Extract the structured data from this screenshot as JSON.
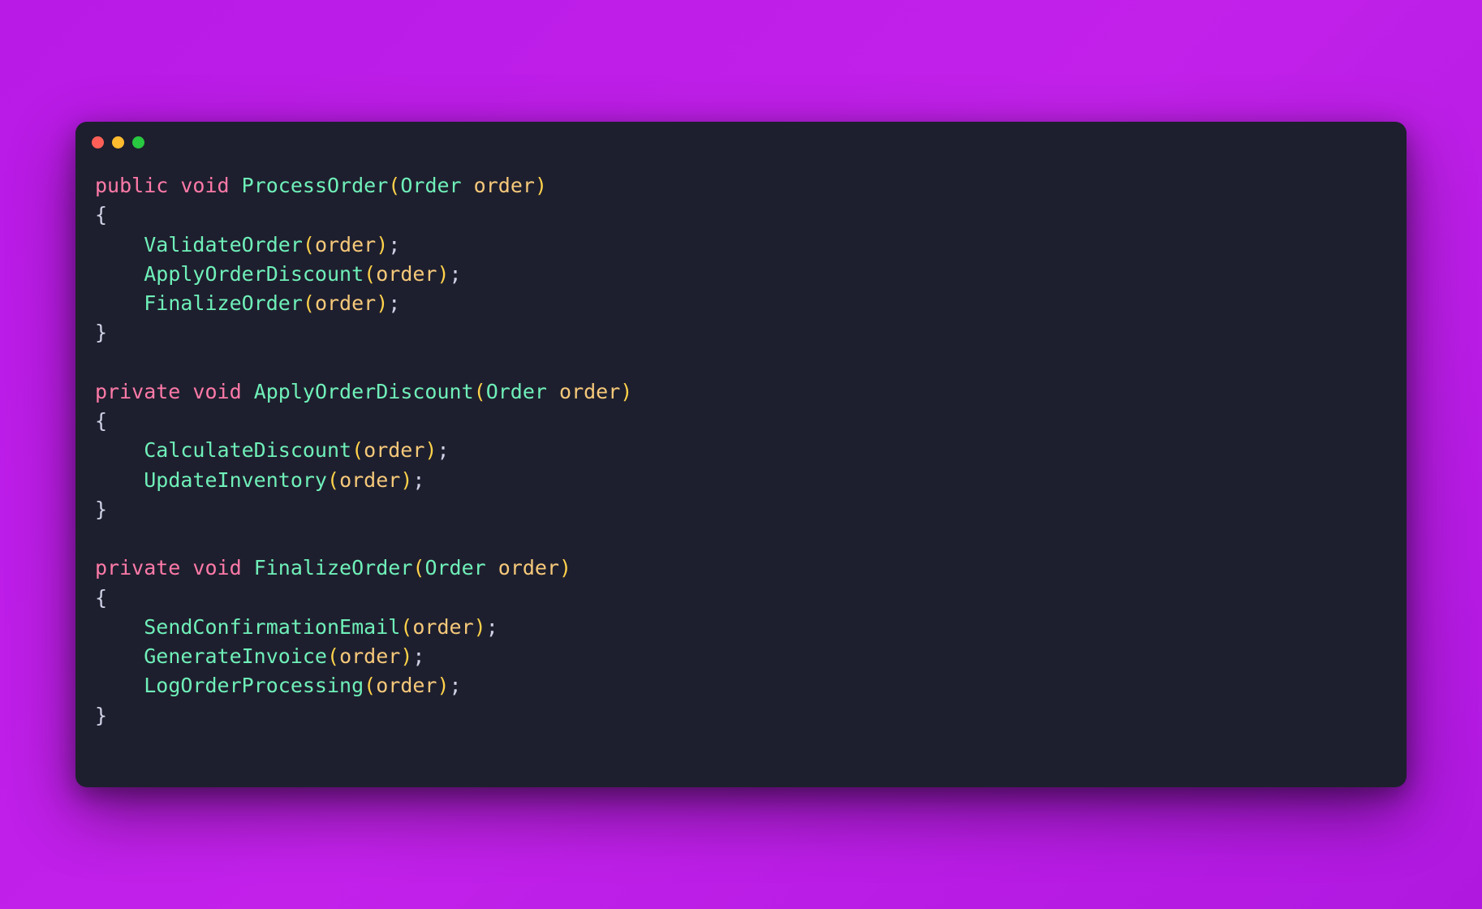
{
  "window": {
    "dots": [
      "red",
      "yellow",
      "green"
    ]
  },
  "code": {
    "kw_public": "public",
    "kw_private": "private",
    "kw_void": "void",
    "type_Order": "Order",
    "param_order": "order",
    "lparen": "(",
    "rparen": ")",
    "lbrace": "{",
    "rbrace": "}",
    "semi": ";",
    "indent": "    ",
    "methods": {
      "processOrder": {
        "name": "ProcessOrder",
        "access": "public",
        "body": [
          "ValidateOrder",
          "ApplyOrderDiscount",
          "FinalizeOrder"
        ]
      },
      "applyOrderDiscount": {
        "name": "ApplyOrderDiscount",
        "access": "private",
        "body": [
          "CalculateDiscount",
          "UpdateInventory"
        ]
      },
      "finalizeOrder": {
        "name": "FinalizeOrder",
        "access": "private",
        "body": [
          "SendConfirmationEmail",
          "GenerateInvoice",
          "LogOrderProcessing"
        ]
      }
    },
    "calls": {
      "ValidateOrder": "ValidateOrder",
      "ApplyOrderDiscount": "ApplyOrderDiscount",
      "FinalizeOrder": "FinalizeOrder",
      "CalculateDiscount": "CalculateDiscount",
      "UpdateInventory": "UpdateInventory",
      "SendConfirmationEmail": "SendConfirmationEmail",
      "GenerateInvoice": "GenerateInvoice",
      "LogOrderProcessing": "LogOrderProcessing"
    }
  }
}
